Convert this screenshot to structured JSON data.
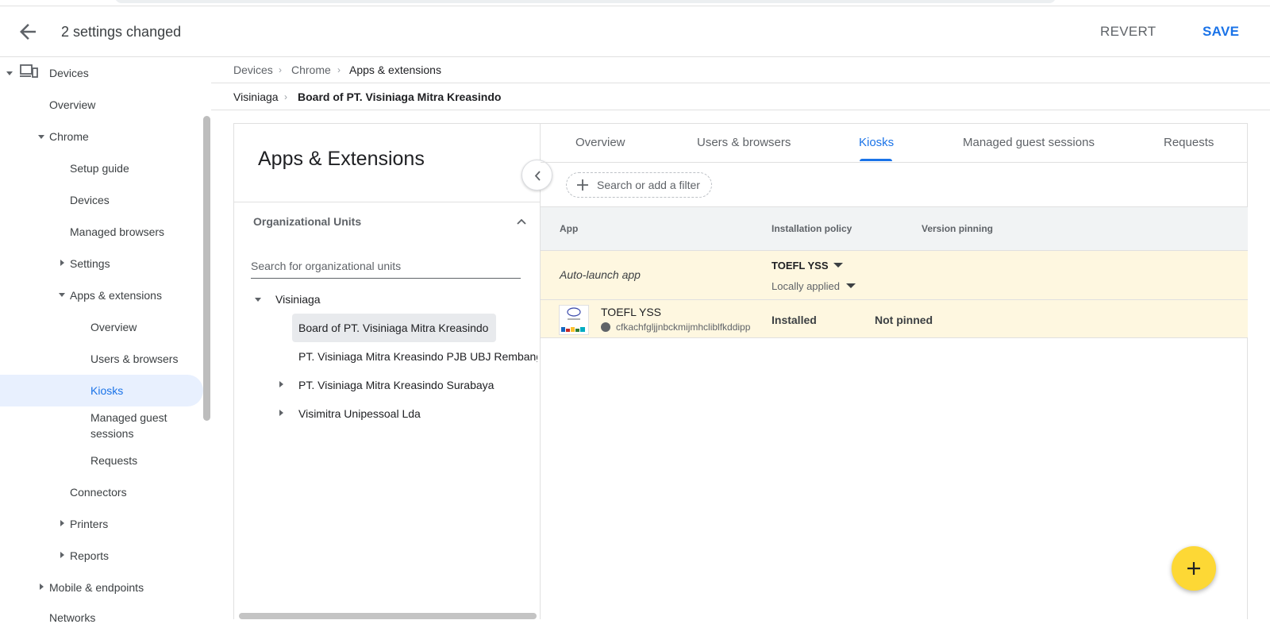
{
  "header": {
    "title": "2 settings changed",
    "revert_label": "REVERT",
    "save_label": "SAVE"
  },
  "sidebar": {
    "devices": "Devices",
    "overview": "Overview",
    "chrome": "Chrome",
    "setup_guide": "Setup guide",
    "devices_sub": "Devices",
    "managed_browsers": "Managed browsers",
    "settings": "Settings",
    "apps_extensions": "Apps & extensions",
    "apps_overview": "Overview",
    "users_browsers": "Users & browsers",
    "kiosks": "Kiosks",
    "managed_guest_1": "Managed guest",
    "managed_guest_2": "sessions",
    "requests": "Requests",
    "connectors": "Connectors",
    "printers": "Printers",
    "reports": "Reports",
    "mobile_endpoints": "Mobile & endpoints",
    "networks": "Networks"
  },
  "breadcrumb": {
    "items": [
      "Devices",
      "Chrome",
      "Apps & extensions"
    ]
  },
  "org_breadcrumb": {
    "parent": "Visiniaga",
    "current": "Board of PT. Visiniaga Mitra Kreasindo"
  },
  "left_panel": {
    "title": "Apps & Extensions",
    "ou_header": "Organizational Units",
    "search_placeholder": "Search for organizational units",
    "tree": {
      "root": "Visiniaga",
      "children": [
        "Board of PT. Visiniaga Mitra Kreasindo",
        "PT. Visiniaga Mitra Kreasindo PJB UBJ Rembang",
        "PT. Visiniaga Mitra Kreasindo Surabaya",
        "Visimitra Unipessoal Lda"
      ]
    }
  },
  "tabs": [
    "Overview",
    "Users & browsers",
    "Kiosks",
    "Managed guest sessions",
    "Requests"
  ],
  "active_tab": "Kiosks",
  "filter": {
    "placeholder": "Search or add a filter"
  },
  "table": {
    "columns": [
      "App",
      "Installation policy",
      "Version pinning"
    ],
    "autolaunch": {
      "label": "Auto-launch app",
      "selected_app": "TOEFL YSS",
      "applied": "Locally applied"
    },
    "rows": [
      {
        "name": "TOEFL YSS",
        "id": "cfkachfgljjnbckmijmhcliblfkddipp",
        "policy": "Installed",
        "pinning": "Not pinned"
      }
    ]
  },
  "colors": {
    "accent": "#1a73e8",
    "row_highlight": "#fef7e0",
    "fab": "#fdd835"
  }
}
